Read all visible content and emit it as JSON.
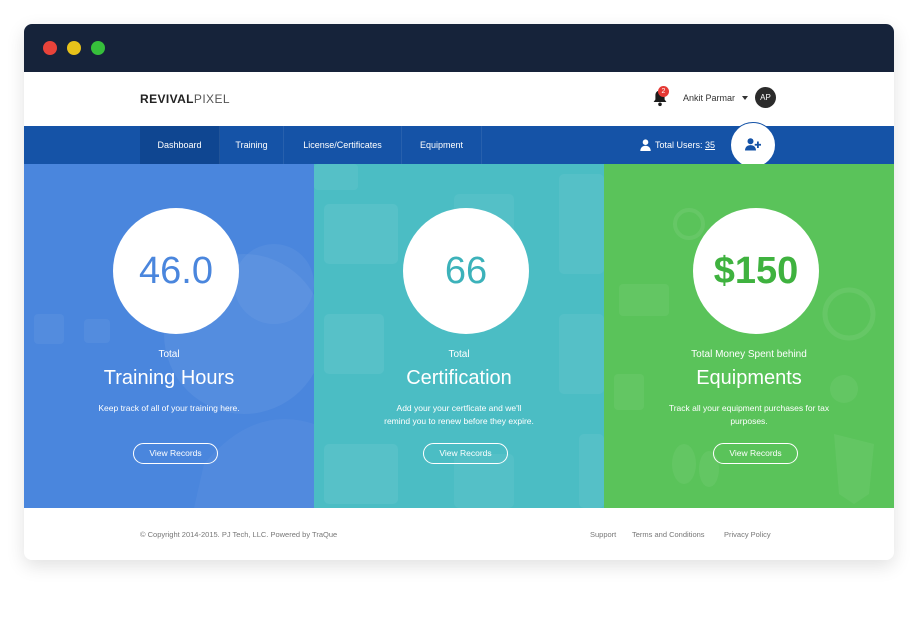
{
  "window": {
    "traffic_lights": [
      "red",
      "yellow",
      "green"
    ]
  },
  "header": {
    "logo_bold": "REVIVAL",
    "logo_light": "PIXEL",
    "notification_count": "2",
    "user_name": "Ankit Parmar",
    "avatar_initials": "AP"
  },
  "nav": {
    "tabs": [
      {
        "label": "Dashboard",
        "active": true
      },
      {
        "label": "Training"
      },
      {
        "label": "License/Certificates"
      },
      {
        "label": "Equipment"
      }
    ],
    "total_users_label": "Total Users:",
    "total_users_count": "35"
  },
  "panels": [
    {
      "value": "46.0",
      "pre_title": "Total",
      "title": "Training Hours",
      "description": "Keep track of all of your training here.",
      "button": "View Records",
      "color": "#4a86dd"
    },
    {
      "value": "66",
      "pre_title": "Total",
      "title": "Certification",
      "description": "Add your your certficate and we'll remind you to renew before they expire.",
      "button": "View Records",
      "color": "#4bbdc4"
    },
    {
      "value": "$150",
      "pre_title": "Total Money Spent behind",
      "title": "Equipments",
      "description": "Track all your equipment purchases for tax purposes.",
      "button": "View Records",
      "color": "#5ac35a"
    }
  ],
  "footer": {
    "copyright": "© Copyright 2014-2015. PJ Tech, LLC. Powered by TraQue",
    "links": [
      "Support",
      "Terms and Conditions",
      "Privacy Policy"
    ]
  },
  "colors": {
    "titlebar": "#16233a",
    "navbar": "#1553a7",
    "nav_active": "#0f4691"
  }
}
